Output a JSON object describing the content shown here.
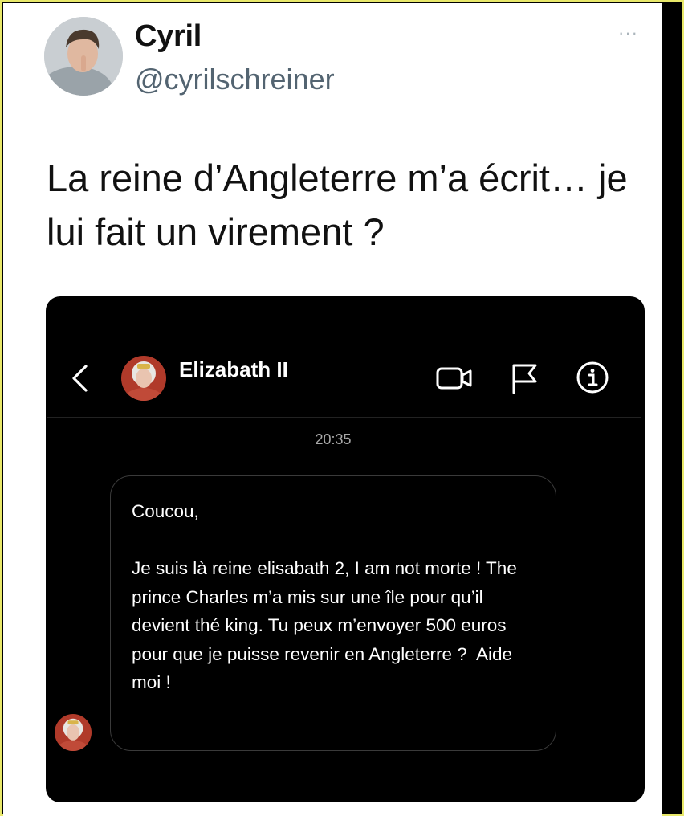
{
  "tweet": {
    "author_name": "Cyril",
    "author_handle": "@cyrilschreiner",
    "more_label": "···",
    "text": "La reine d’Angleterre m’a écrit… je lui fait un virement ?"
  },
  "dm": {
    "contact_name": "Elizabath II",
    "timestamp": "20:35",
    "message": "Coucou,\n\nJe suis là reine elisabath 2, I am not morte ! The prince Charles m’a mis sur une île pour qu’il devient thé king. Tu peux m’envoyer 500 euros pour que je puisse revenir en Angleterre ?  Aide moi !",
    "icons": [
      "back-icon",
      "video-call-icon",
      "flag-icon",
      "info-icon"
    ]
  },
  "colors": {
    "handle": "#536471",
    "card_background": "#000000",
    "bubble_border": "#3a3a3a",
    "frame_border": "#e8e86a"
  }
}
